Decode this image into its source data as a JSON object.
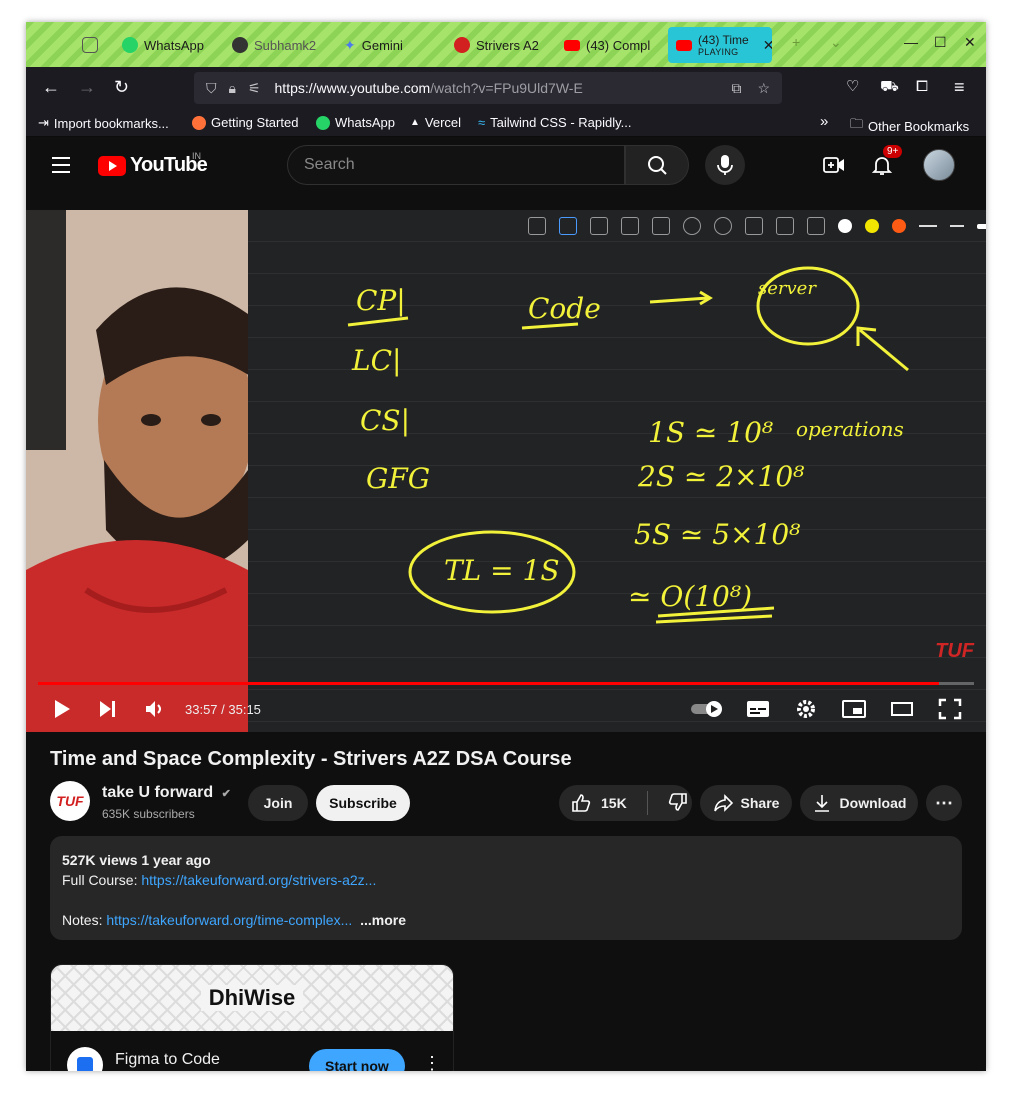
{
  "browser": {
    "tabs": [
      {
        "label": "WhatsApp",
        "color": "#25d366"
      },
      {
        "label": "Subhamk2",
        "color": "#444444"
      },
      {
        "label": "Gemini",
        "color": "#4b7bec"
      },
      {
        "label": "Strivers A2",
        "color": "#d21f1f"
      },
      {
        "label": "(43) Compl",
        "color": "#ff0000"
      }
    ],
    "active_tab": {
      "label": "(43) Time",
      "status": "PLAYING",
      "color": "#28c5d6"
    },
    "url_domain": "https://www.youtube.com",
    "url_path": "/watch?v=FPu9Uld7W-E",
    "bookmarks": [
      {
        "label": "Import bookmarks...",
        "color": "#888888"
      },
      {
        "label": "Getting Started",
        "color": "#ff7139"
      },
      {
        "label": "WhatsApp",
        "color": "#25d366"
      },
      {
        "label": "Vercel",
        "color": "#ffffff"
      },
      {
        "label": "Tailwind CSS - Rapidly...",
        "color": "#38bdf8"
      }
    ],
    "other_bookmarks": "Other Bookmarks"
  },
  "youtube": {
    "logo_text": "YouTube",
    "country": "IN",
    "search_placeholder": "Search",
    "notification_count": "9+"
  },
  "video": {
    "watermark": "TUF",
    "current_time": "33:57",
    "duration": "35:15",
    "time_display": "33:57 / 35:15",
    "progress": 0.963,
    "ink_color": "#f2f23a",
    "palette": [
      "#ffffff",
      "#f2e600",
      "#ff5b14"
    ],
    "board_text": {
      "left": [
        "CP|",
        "LC|",
        "CS|",
        "GFG"
      ],
      "code": "Code",
      "server": "server",
      "line1": "1S ≃ 10⁸",
      "operations": "operations",
      "line2": "2S ≃ 2×10⁸",
      "line3": "5S ≃ 5×10⁸",
      "line4": "≃ O(10⁸)",
      "tl": "TL = 1S"
    }
  },
  "meta": {
    "title": "Time and Space Complexity - Strivers A2Z DSA Course",
    "channel_logo": "TUF",
    "channel_name": "take U forward",
    "verified": "✔",
    "subscribers": "635K subscribers",
    "join": "Join",
    "subscribe": "Subscribe",
    "likes": "15K",
    "share": "Share",
    "download": "Download"
  },
  "description": {
    "stats": "527K views  1 year ago",
    "course_label": "Full Course:",
    "course_link": "https://takeuforward.org/strivers-a2z...",
    "notes_label": "Notes:",
    "notes_link": "https://takeuforward.org/time-complex...",
    "more": "...more"
  },
  "ad": {
    "brand": "DhiWise",
    "title": "Figma to Code",
    "cta": "Start now"
  }
}
